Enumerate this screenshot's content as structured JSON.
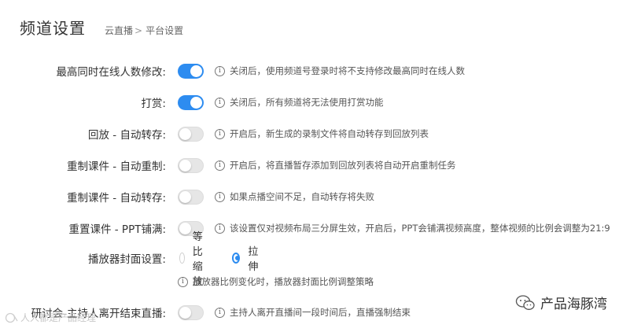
{
  "header": {
    "title": "频道设置",
    "breadcrumb": {
      "parent": "云直播",
      "separator": ">",
      "current": "平台设置"
    }
  },
  "settings": [
    {
      "label": "最高同时在线人数修改:",
      "enabled": true,
      "hint": "关闭后，使用频道号登录时将不支持修改最高同时在线人数"
    },
    {
      "label": "打赏:",
      "enabled": true,
      "hint": "关闭后，所有频道将无法使用打赏功能"
    },
    {
      "label": "回放 - 自动转存:",
      "enabled": false,
      "hint": "开启后，新生成的录制文件将自动转存到回放列表"
    },
    {
      "label": "重制课件 - 自动重制:",
      "enabled": false,
      "hint": "开启后，将直播暂存添加到回放列表将自动开启重制任务"
    },
    {
      "label": "重制课件 - 自动转存:",
      "enabled": false,
      "hint": "如果点播空间不足，自动转存将失败"
    },
    {
      "label": "重置课件 - PPT铺满:",
      "enabled": false,
      "hint": "该设置仅对视频布局三分屏生效，开启后，PPT会铺满视频高度，整体视频的比例会调整为21:9"
    }
  ],
  "player_cover": {
    "label": "播放器封面设置:",
    "options": [
      {
        "label": "等比缩放",
        "selected": false
      },
      {
        "label": "拉伸",
        "selected": true
      }
    ],
    "hint": "播放器比例变化时，播放器封面比例调整策略"
  },
  "seminar": {
    "label": "研讨会-主持人离开结束直播:",
    "enabled": false,
    "hint": "主持人离开直播间一段时间后，直播强制结束"
  },
  "watermarks": {
    "left": "人人都是产品经理",
    "right": "产品海豚湾"
  },
  "colors": {
    "accent": "#2d8cf0",
    "toggle_off": "#e6e6e6"
  }
}
